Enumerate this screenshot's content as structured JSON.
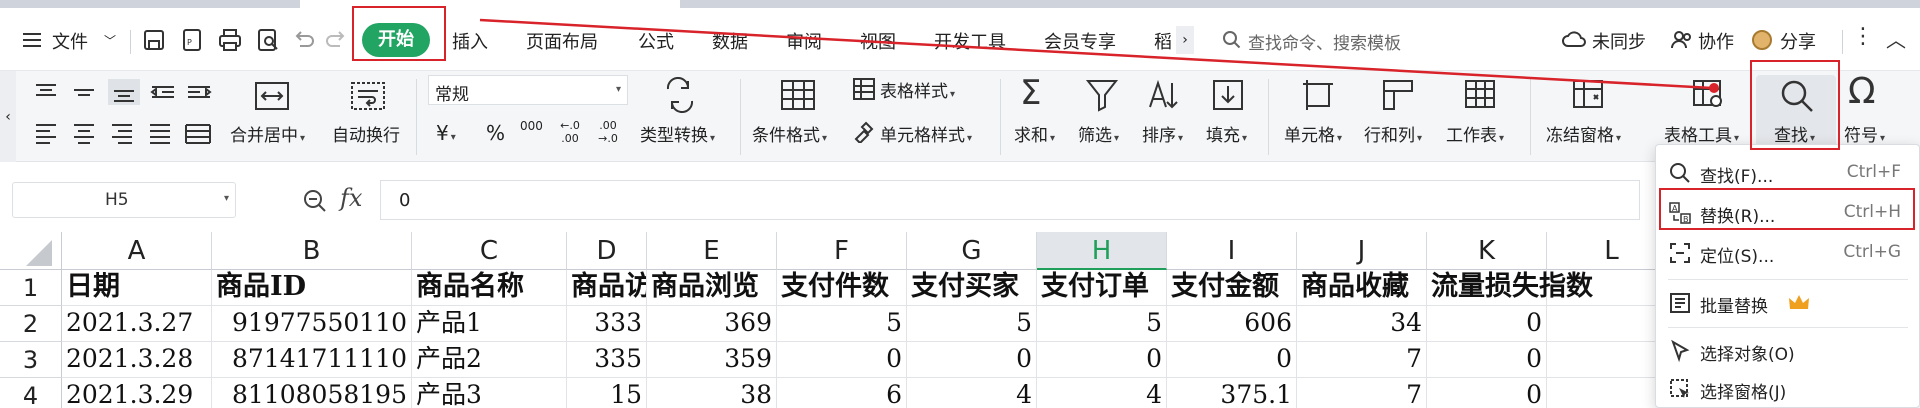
{
  "menubar": {
    "file_label": "文件",
    "tabs": [
      "开始",
      "插入",
      "页面布局",
      "公式",
      "数据",
      "审阅",
      "视图",
      "开发工具",
      "会员专享",
      "稻"
    ],
    "search_placeholder": "查找命令、搜索模板",
    "sync_label": "未同步",
    "collab_label": "协作",
    "share_label": "分享"
  },
  "ribbon": {
    "merge_label": "合并居中",
    "wrap_label": "自动换行",
    "number_format": "常规",
    "currency_symbol": "¥",
    "percent_symbol": "%",
    "thousands_symbol": "000",
    "dec_inc": "←.0 .00",
    "dec_dec": ".00 →.0",
    "type_convert_label": "类型转换",
    "cond_format_label": "条件格式",
    "table_style_label": "表格样式",
    "cell_style_label": "单元格样式",
    "sum_label": "求和",
    "filter_label": "筛选",
    "sort_label": "排序",
    "fill_label": "填充",
    "cell_label": "单元格",
    "rowcol_label": "行和列",
    "sheet_label": "工作表",
    "freeze_label": "冻结窗格",
    "table_tools_label": "表格工具",
    "find_label": "查找",
    "symbol_label": "符号"
  },
  "formulabar": {
    "cell_ref": "H5",
    "fx_symbol": "fx",
    "value": "0"
  },
  "grid": {
    "columns": [
      "A",
      "B",
      "C",
      "D",
      "E",
      "F",
      "G",
      "H",
      "I",
      "J",
      "K",
      "L"
    ],
    "selected_column": "H",
    "rows": [
      {
        "num": "1",
        "cells": [
          "日期",
          "商品ID",
          "商品名称",
          "商品访",
          "商品浏览",
          "支付件数",
          "支付买家",
          "支付订单",
          "支付金额",
          "商品收藏",
          "流量损失指数",
          ""
        ]
      },
      {
        "num": "2",
        "cells": [
          "2021.3.27",
          "91977550110",
          "产品1",
          "333",
          "369",
          "5",
          "5",
          "5",
          "606",
          "34",
          "0",
          ""
        ]
      },
      {
        "num": "3",
        "cells": [
          "2021.3.28",
          "87141711110",
          "产品2",
          "335",
          "359",
          "0",
          "0",
          "0",
          "0",
          "7",
          "0",
          ""
        ]
      },
      {
        "num": "4",
        "cells": [
          "2021.3.29",
          "81108058195",
          "产品3",
          "15",
          "38",
          "6",
          "4",
          "4",
          "375.1",
          "7",
          "0",
          ""
        ]
      }
    ]
  },
  "dropdown": {
    "items": [
      {
        "label": "查找(F)...",
        "shortcut": "Ctrl+F"
      },
      {
        "label": "替换(R)...",
        "shortcut": "Ctrl+H"
      },
      {
        "label": "定位(S)...",
        "shortcut": "Ctrl+G"
      },
      {
        "label": "批量替换",
        "shortcut": ""
      },
      {
        "label": "选择对象(O)",
        "shortcut": ""
      },
      {
        "label": "选择窗格(J)",
        "shortcut": ""
      }
    ]
  },
  "colors": {
    "accent_green": "#22a463",
    "highlight_red": "#d9232a",
    "premium_gold": "#f0a020"
  }
}
